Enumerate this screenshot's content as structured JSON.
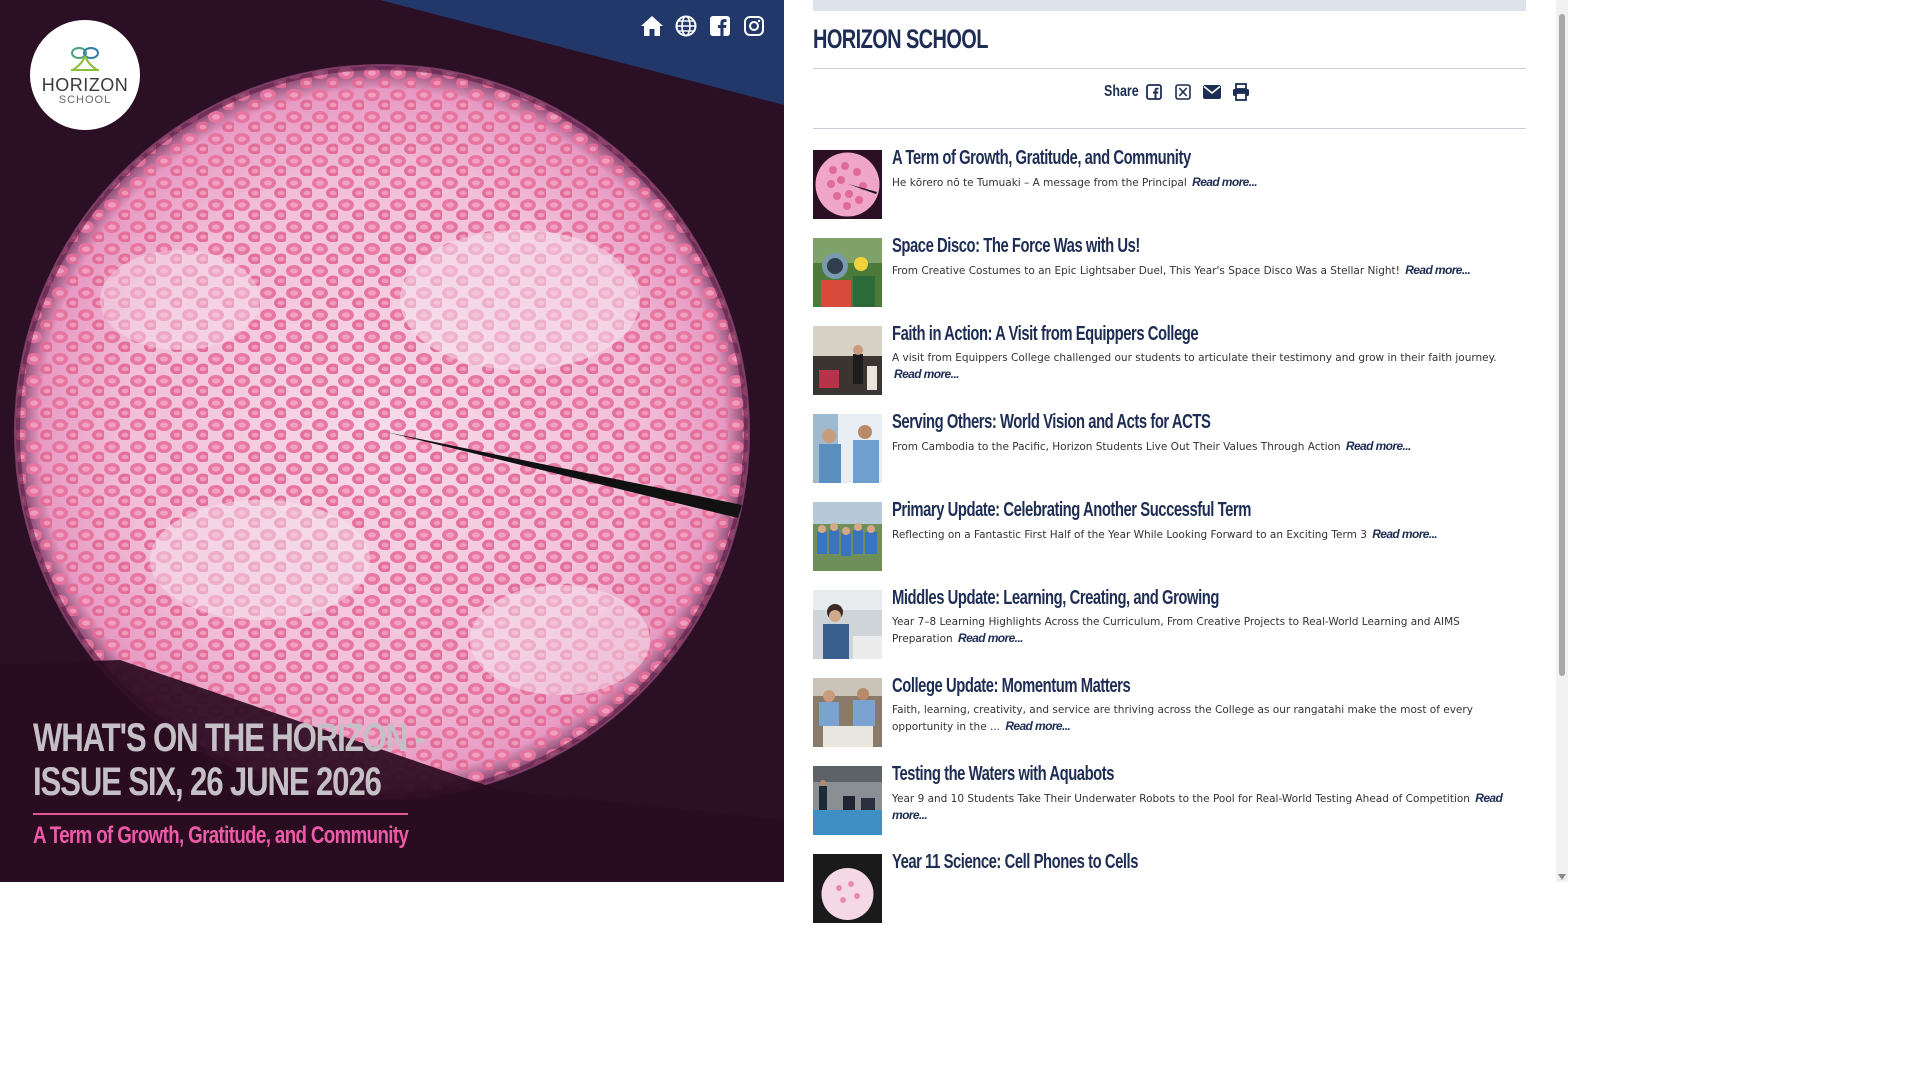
{
  "hero": {
    "logo_line1": "HORIZON",
    "logo_line2": "SCHOOL",
    "title": "WHAT'S ON THE HORIZON - ISSUE SIX, 26 JUNE 2026",
    "subtitle": "A Term of Growth, Gratitude, and Community",
    "icons": [
      "home-icon",
      "globe-icon",
      "facebook-icon",
      "instagram-icon"
    ],
    "accent_color": "#e2559b",
    "banner_color": "#22386a"
  },
  "panel": {
    "school_title": "HORIZON SCHOOL",
    "share_label": "Share",
    "share_icons": [
      "facebook-icon",
      "x-icon",
      "email-icon",
      "print-icon"
    ],
    "heading_color": "#1e2d54"
  },
  "articles": [
    {
      "title": "A Term of Growth, Gratitude, and Community",
      "desc": "He kōrero nō te Tumuaki – A message from the Principal",
      "more": "Read more..."
    },
    {
      "title": "Space Disco: The Force Was with Us!",
      "desc": "From Creative Costumes to an Epic Lightsaber Duel, This Year's Space Disco Was a Stellar Night!",
      "more": "Read more..."
    },
    {
      "title": "Faith in Action: A Visit from Equippers College",
      "desc": "A visit from Equippers College challenged our students to articulate their testimony and grow in their faith journey.",
      "more": "Read more..."
    },
    {
      "title": "Serving Others: World Vision and Acts for ACTS",
      "desc": "From Cambodia to the Pacific, Horizon Students Live Out Their Values Through Action",
      "more": "Read more..."
    },
    {
      "title": "Primary Update: Celebrating Another Successful Term",
      "desc": "Reflecting on a Fantastic First Half of the Year While Looking Forward to an Exciting Term 3",
      "more": "Read more..."
    },
    {
      "title": "Middles Update: Learning, Creating, and Growing",
      "desc": "Year 7–8 Learning Highlights Across the Curriculum, From Creative Projects to Real-World Learning and AIMS Preparation",
      "more": "Read more..."
    },
    {
      "title": "College Update: Momentum Matters",
      "desc": "Faith, learning, creativity, and service are thriving across the College as our rangatahi make the most of every opportunity in the ...",
      "more": "Read more..."
    },
    {
      "title": "Testing the Waters with Aquabots",
      "desc": "Year 9 and 10 Students Take Their Underwater Robots to the Pool for Real-World Testing Ahead of Competition",
      "more": "Read more..."
    },
    {
      "title": "Year 11 Science: Cell Phones to Cells",
      "desc": "",
      "more": ""
    }
  ]
}
